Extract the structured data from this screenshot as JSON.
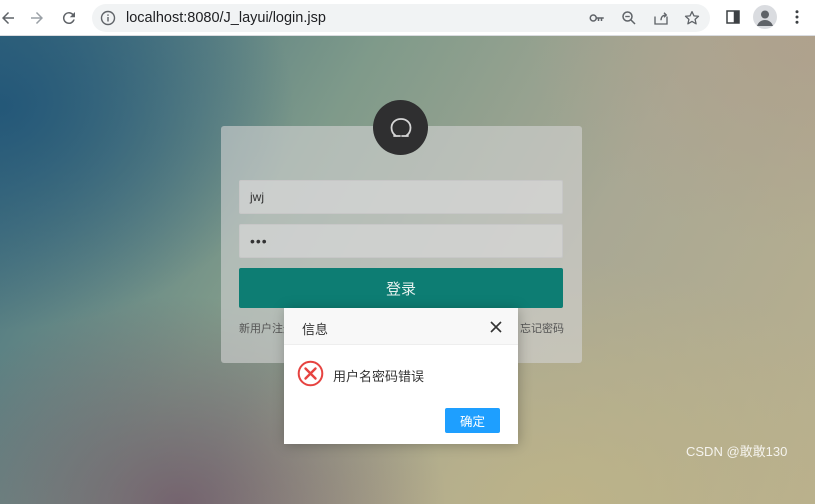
{
  "browser": {
    "url": "localhost:8080/J_layui/login.jsp",
    "icons": [
      "back-arrow-icon",
      "forward-arrow-icon",
      "reload-icon",
      "info-icon",
      "key-icon",
      "zoom-icon",
      "share-icon",
      "star-icon",
      "side-panel-icon",
      "profile-icon",
      "kebab-menu-icon"
    ]
  },
  "login": {
    "username_value": "jwj",
    "password_value": "•••",
    "submit_label": "登录",
    "register_link": "新用户注册",
    "forgot_link": "忘记密码"
  },
  "dialog": {
    "title": "信息",
    "message": "用户名密码错误",
    "ok_label": "确定",
    "icon": "error-circle-icon"
  },
  "watermark": "CSDN @敢敢130",
  "colors": {
    "login_button": "#0d7d73",
    "dialog_button": "#1e9fff",
    "error_icon": "#e64340"
  }
}
